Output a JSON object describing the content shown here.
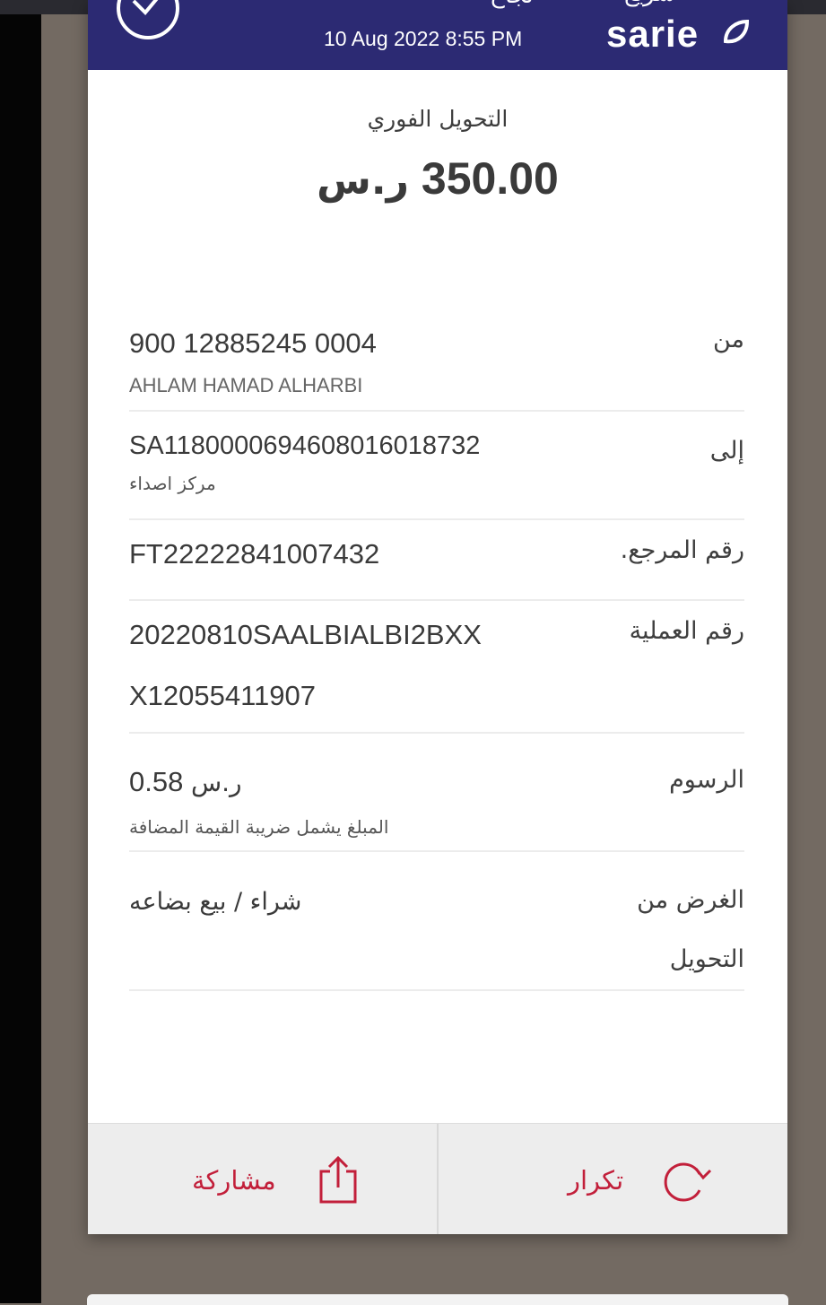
{
  "header": {
    "status_ar": "نجاح",
    "date": "10 Aug 2022 8:55 PM",
    "logo_ar": "سريع",
    "logo": "sarie"
  },
  "transfer": {
    "title": "التحويل الفوري",
    "amount": "350.00",
    "currency": "ر.س"
  },
  "details": {
    "from": {
      "label": "من",
      "value": "900  12885245  0004",
      "sub": "AHLAM HAMAD ALHARBI"
    },
    "to": {
      "label": "إلى",
      "value": "SA1180000694608016018732",
      "sub": "مركز اصداء"
    },
    "reference": {
      "label": "رقم المرجع.",
      "value": "FT22222841007432"
    },
    "transaction": {
      "label": "رقم العملية",
      "value_line1": "20220810SAALBIALBI2BXX",
      "value_line2": "X12055411907"
    },
    "fees": {
      "label": "الرسوم",
      "value": "0.58",
      "currency": "ر.س",
      "note": "المبلغ يشمل ضريبة القيمة المضافة"
    },
    "purpose": {
      "label_line1": "الغرض من",
      "label_line2": "التحويل",
      "value": "شراء / بيع بضاعه"
    }
  },
  "actions": {
    "share": "مشاركة",
    "repeat": "تكرار"
  },
  "colors": {
    "header_bg": "#2c2a73",
    "accent_red": "#c21f3a"
  }
}
